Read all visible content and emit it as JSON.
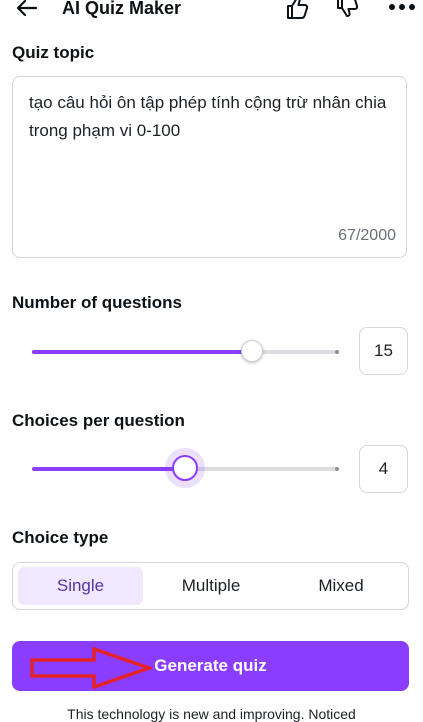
{
  "header": {
    "title": "AI Quiz Maker",
    "icons": [
      "arrow-left-icon",
      "thumbs-up-icon",
      "thumbs-down-icon",
      "more-icon"
    ]
  },
  "topic": {
    "label": "Quiz topic",
    "value": "tạo câu hỏi ôn tập phép tính cộng trừ nhân chia trong phạm vi 0-100",
    "char_count": "67/2000"
  },
  "questions": {
    "label": "Number of questions",
    "value": "15",
    "fraction": 0.72
  },
  "choices": {
    "label": "Choices per question",
    "value": "4",
    "fraction": 0.5
  },
  "choice_type": {
    "label": "Choice type",
    "options": [
      "Single",
      "Multiple",
      "Mixed"
    ],
    "selected": "Single"
  },
  "generate": {
    "label": "Generate quiz"
  },
  "footer": {
    "text": "This technology is new and improving. Noticed"
  },
  "colors": {
    "accent": "#8b3dff",
    "annotation_arrow": "#e4222b"
  }
}
